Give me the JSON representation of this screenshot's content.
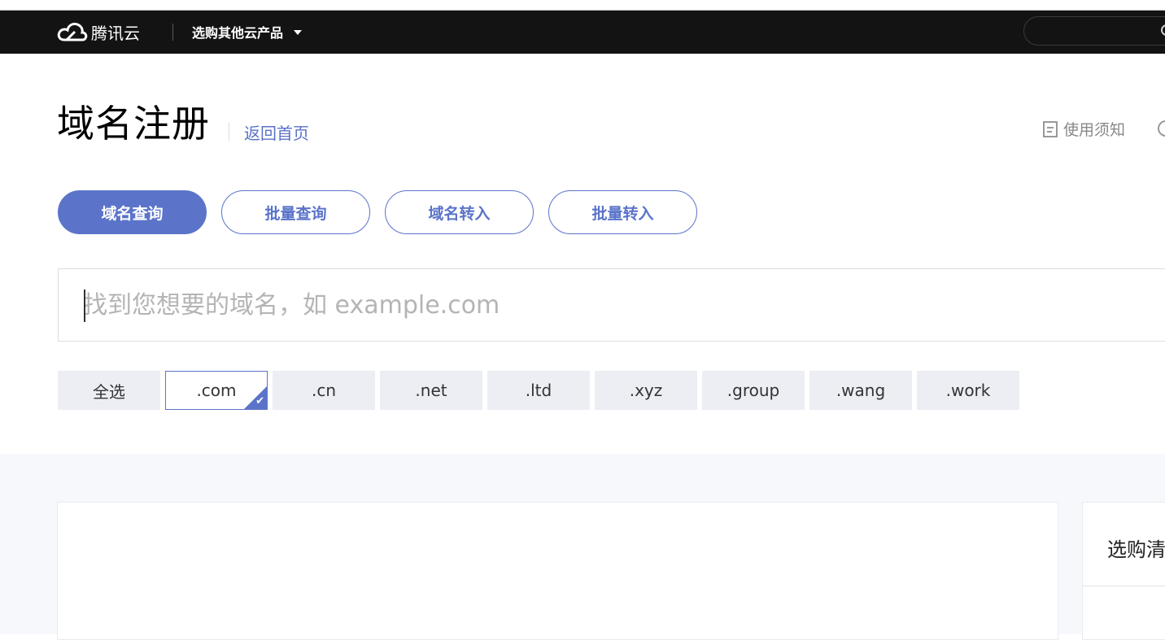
{
  "navbar": {
    "logo_text": "腾讯云",
    "products_label": "选购其他云产品",
    "search_icon": "search-icon"
  },
  "header": {
    "title": "域名注册",
    "back_link": "返回首页",
    "notice_label": "使用须知"
  },
  "tabs": [
    {
      "label": "域名查询",
      "active": true
    },
    {
      "label": "批量查询",
      "active": false
    },
    {
      "label": "域名转入",
      "active": false
    },
    {
      "label": "批量转入",
      "active": false
    }
  ],
  "search": {
    "placeholder": "找到您想要的域名，如 example.com",
    "value": ""
  },
  "tlds": [
    {
      "label": "全选",
      "selected": false
    },
    {
      "label": ".com",
      "selected": true
    },
    {
      "label": ".cn",
      "selected": false
    },
    {
      "label": ".net",
      "selected": false
    },
    {
      "label": ".ltd",
      "selected": false
    },
    {
      "label": ".xyz",
      "selected": false
    },
    {
      "label": ".group",
      "selected": false
    },
    {
      "label": ".wang",
      "selected": false
    },
    {
      "label": ".work",
      "selected": false
    }
  ],
  "cart": {
    "title": "选购清"
  },
  "colors": {
    "accent": "#5b74c9",
    "navbar_bg": "#131313",
    "tld_bg": "#eceef4"
  }
}
